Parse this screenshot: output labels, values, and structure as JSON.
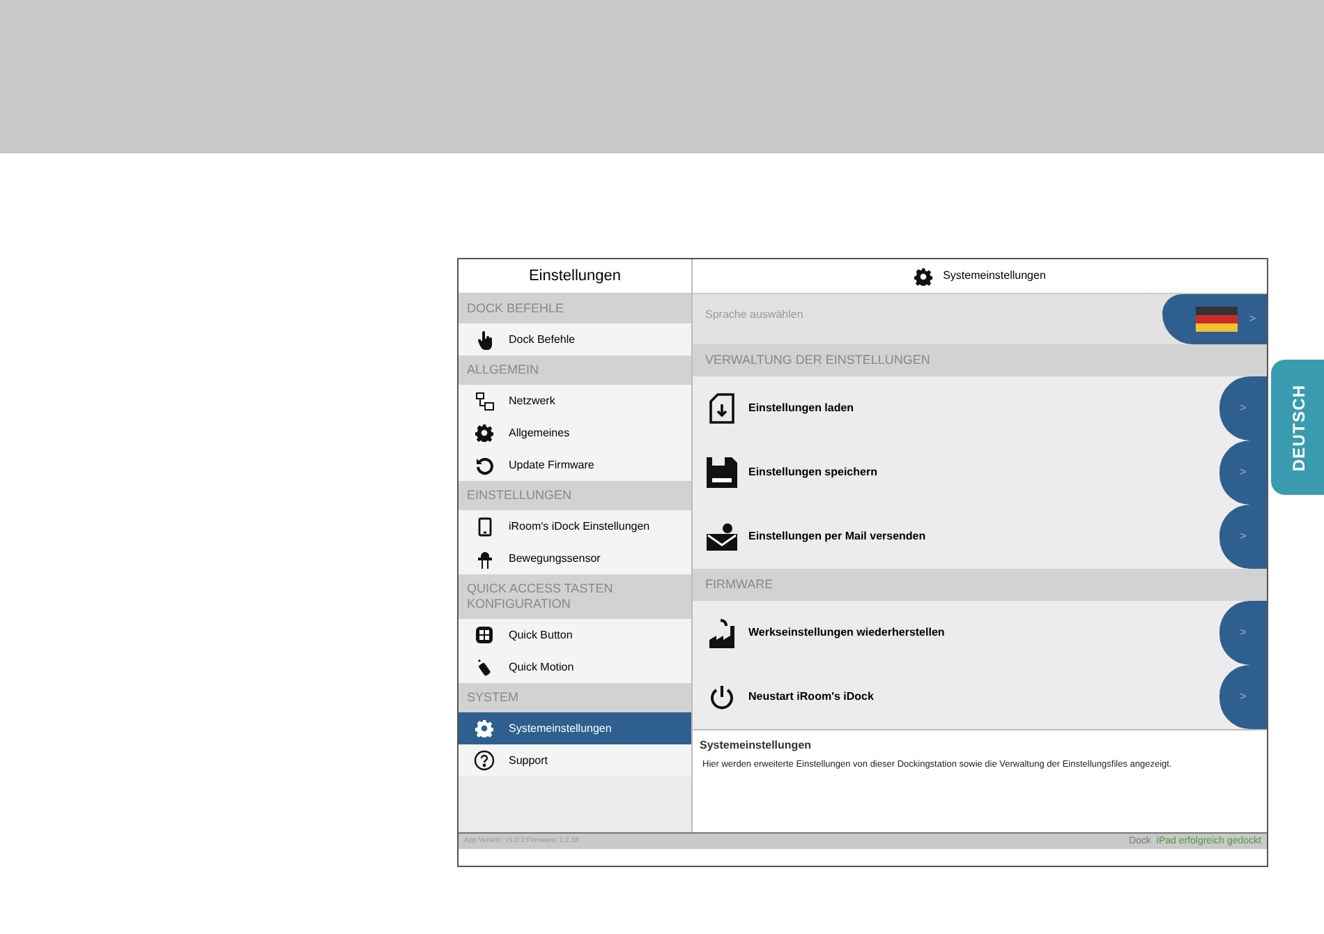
{
  "sidebar": {
    "title": "Einstellungen",
    "sections": [
      {
        "heading": "DOCK BEFEHLE",
        "items": [
          {
            "label": "Dock Befehle",
            "selected": false
          }
        ]
      },
      {
        "heading": "ALLGEMEIN",
        "items": [
          {
            "label": "Netzwerk",
            "selected": false
          },
          {
            "label": "Allgemeines",
            "selected": false
          },
          {
            "label": "Update Firmware",
            "selected": false
          }
        ]
      },
      {
        "heading": "EINSTELLUNGEN",
        "items": [
          {
            "label": "iRoom's iDock Einstellungen",
            "selected": false
          },
          {
            "label": "Bewegungssensor",
            "selected": false
          }
        ]
      },
      {
        "heading": "QUICK ACCESS TASTEN KONFIGURATION",
        "items": [
          {
            "label": "Quick Button",
            "selected": false
          },
          {
            "label": "Quick Motion",
            "selected": false
          }
        ]
      },
      {
        "heading": "SYSTEM",
        "items": [
          {
            "label": "Systemeinstellungen",
            "selected": true
          },
          {
            "label": "Support",
            "selected": false
          }
        ]
      }
    ],
    "version": "App Version: v1.0.2 Firmware: 1.2.16"
  },
  "main": {
    "title": "Systemeinstellungen",
    "language_row": {
      "label": "Sprache auswählen",
      "chevron": ">"
    },
    "sections": [
      {
        "heading": "VERWALTUNG DER EINSTELLUNGEN",
        "rows": [
          {
            "label": "Einstellungen laden",
            "chevron": ">"
          },
          {
            "label": "Einstellungen speichern",
            "chevron": ">"
          },
          {
            "label": "Einstellungen per Mail versenden",
            "chevron": ">"
          }
        ]
      },
      {
        "heading": "FIRMWARE",
        "rows": [
          {
            "label": "Werkseinstellungen wiederherstellen",
            "chevron": ">"
          },
          {
            "label": "Neustart iRoom's iDock",
            "chevron": ">"
          }
        ]
      }
    ],
    "description": {
      "title": "Systemeinstellungen",
      "text": "Hier werden erweiterte Einstellungen von dieser Dockingstation sowie die Verwaltung der Einstellungsfiles angezeigt."
    },
    "status_bar": {
      "label": "Dock",
      "status": "iPad erfolgreich gedockt"
    }
  },
  "side_tab": "DEUTSCH"
}
